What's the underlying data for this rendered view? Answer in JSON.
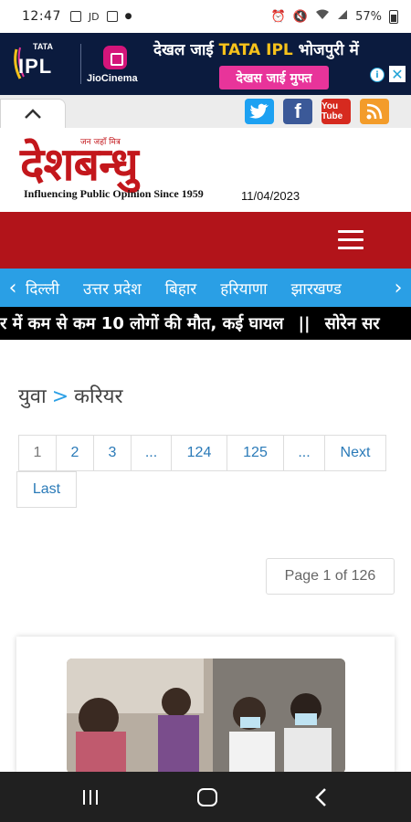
{
  "status_bar": {
    "time": "12:47",
    "icons_left": [
      "image-icon",
      "jd-icon",
      "app-icon",
      "dot"
    ],
    "jd_label": "JD",
    "battery": "57%"
  },
  "ad": {
    "brand_top": "TATA",
    "brand": "IPL",
    "partner": "JioCinema",
    "headline_pre": "देखल जाई ",
    "headline_hl": "TATA IPL",
    "headline_post": " भोजपुरी में",
    "cta": "देखस जाई मुफ्त",
    "info": "i",
    "close": "✕"
  },
  "social": {
    "twitter": "t",
    "facebook": "f",
    "youtube": "You Tube",
    "rss": "rss"
  },
  "masthead": {
    "tag": "जन जहाँ मित्र",
    "logo": "देशबन्धु",
    "tagline": "Influencing Public Opinion Since 1959",
    "date": "11/04/2023"
  },
  "categories": [
    "दिल्ली",
    "उत्तर प्रदेश",
    "बिहार",
    "हरियाणा",
    "झारखण्ड"
  ],
  "ticker": {
    "text": "र में कम से कम 10 लोगों की मौत, कई घायल",
    "sep": "||",
    "next": "सोरेन सर"
  },
  "breadcrumb": {
    "parent": "युवा",
    "sep": ">",
    "current": "करियर"
  },
  "pagination": {
    "pages": [
      "1",
      "2",
      "3",
      "...",
      "124",
      "125",
      "...",
      "Next",
      "Last"
    ],
    "active": "1",
    "page_count": "Page 1 of 126"
  },
  "colors": {
    "brand_red": "#b2141a",
    "nav_blue": "#2a9fe5",
    "link_blue": "#2a7ab8"
  }
}
